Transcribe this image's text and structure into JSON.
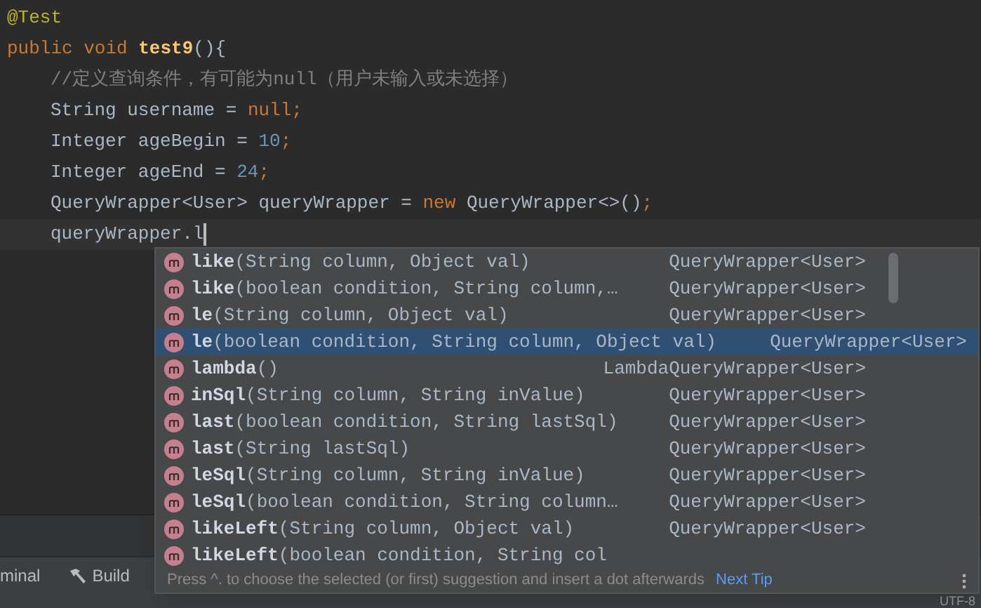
{
  "code_lines": [
    {
      "current": false,
      "segments": [
        {
          "kind": "annotation",
          "text": "@Test"
        }
      ]
    },
    {
      "current": false,
      "segments": [
        {
          "kind": "keyword",
          "text": "public void "
        },
        {
          "kind": "method",
          "text": "test9"
        },
        {
          "kind": "plain",
          "text": "(){"
        }
      ]
    },
    {
      "children": [
        {
          "current": false,
          "segments": [
            {
              "kind": "comment",
              "text": "//定义查询条件，有可能为null（用户未输入或未选择）"
            }
          ]
        },
        {
          "current": false,
          "segments": [
            {
              "kind": "plain",
              "text": "String username = "
            },
            {
              "kind": "keyword",
              "text": "null"
            },
            {
              "kind": "keyword",
              "text": ";"
            }
          ]
        },
        {
          "current": false,
          "segments": [
            {
              "kind": "plain",
              "text": "Integer ageBegin = "
            },
            {
              "kind": "number",
              "text": "10"
            },
            {
              "kind": "keyword",
              "text": ";"
            }
          ]
        },
        {
          "current": false,
          "segments": [
            {
              "kind": "plain",
              "text": "Integer ageEnd = "
            },
            {
              "kind": "number",
              "text": "24"
            },
            {
              "kind": "keyword",
              "text": ";"
            }
          ]
        },
        {
          "current": false,
          "segments": [
            {
              "kind": "plain",
              "text": "QueryWrapper<User> queryWrapper = "
            },
            {
              "kind": "keyword",
              "text": "new"
            },
            {
              "kind": "plain",
              "text": " QueryWrapper<>()"
            },
            {
              "kind": "keyword",
              "text": ";"
            }
          ]
        },
        {
          "current": true,
          "segments": [
            {
              "kind": "plain",
              "text": "queryWrapper.l"
            }
          ]
        }
      ]
    }
  ],
  "completion": {
    "items": [
      {
        "name": "like",
        "params": "(String column, Object val)",
        "type": "QueryWrapper<User>",
        "selected": false
      },
      {
        "name": "like",
        "params": "(boolean condition, String column,…",
        "type": "QueryWrapper<User>",
        "selected": false
      },
      {
        "name": "le",
        "params": "(String column, Object val)",
        "type": "QueryWrapper<User>",
        "selected": false
      },
      {
        "name": "le",
        "params": "(boolean condition, String column, Object val)",
        "type": "QueryWrapper<User>",
        "selected": true
      },
      {
        "name": "lambda",
        "params": "()",
        "type": "LambdaQueryWrapper<User>",
        "selected": false
      },
      {
        "name": "inSql",
        "params": "(String column, String inValue)",
        "type": "QueryWrapper<User>",
        "selected": false
      },
      {
        "name": "last",
        "params": "(boolean condition, String lastSql)",
        "type": "QueryWrapper<User>",
        "selected": false
      },
      {
        "name": "last",
        "params": "(String lastSql)",
        "type": "QueryWrapper<User>",
        "selected": false
      },
      {
        "name": "leSql",
        "params": "(String column, String inValue)",
        "type": "QueryWrapper<User>",
        "selected": false
      },
      {
        "name": "leSql",
        "params": "(boolean condition, String column…",
        "type": "QueryWrapper<User>",
        "selected": false
      },
      {
        "name": "likeLeft",
        "params": "(String column, Object val)",
        "type": "QueryWrapper<User>",
        "selected": false
      },
      {
        "name": "likeLeft",
        "params": "(boolean condition, String col",
        "selected": false
      }
    ],
    "hint": "Press ^. to choose the selected (or first) suggestion and insert a dot afterwards",
    "hint_link": "Next Tip"
  },
  "tool_tabs": [
    {
      "label": "minal",
      "kind": "terminal"
    },
    {
      "label": "Build",
      "kind": "build"
    }
  ],
  "status_bar": {
    "encoding": "UTF-8"
  }
}
